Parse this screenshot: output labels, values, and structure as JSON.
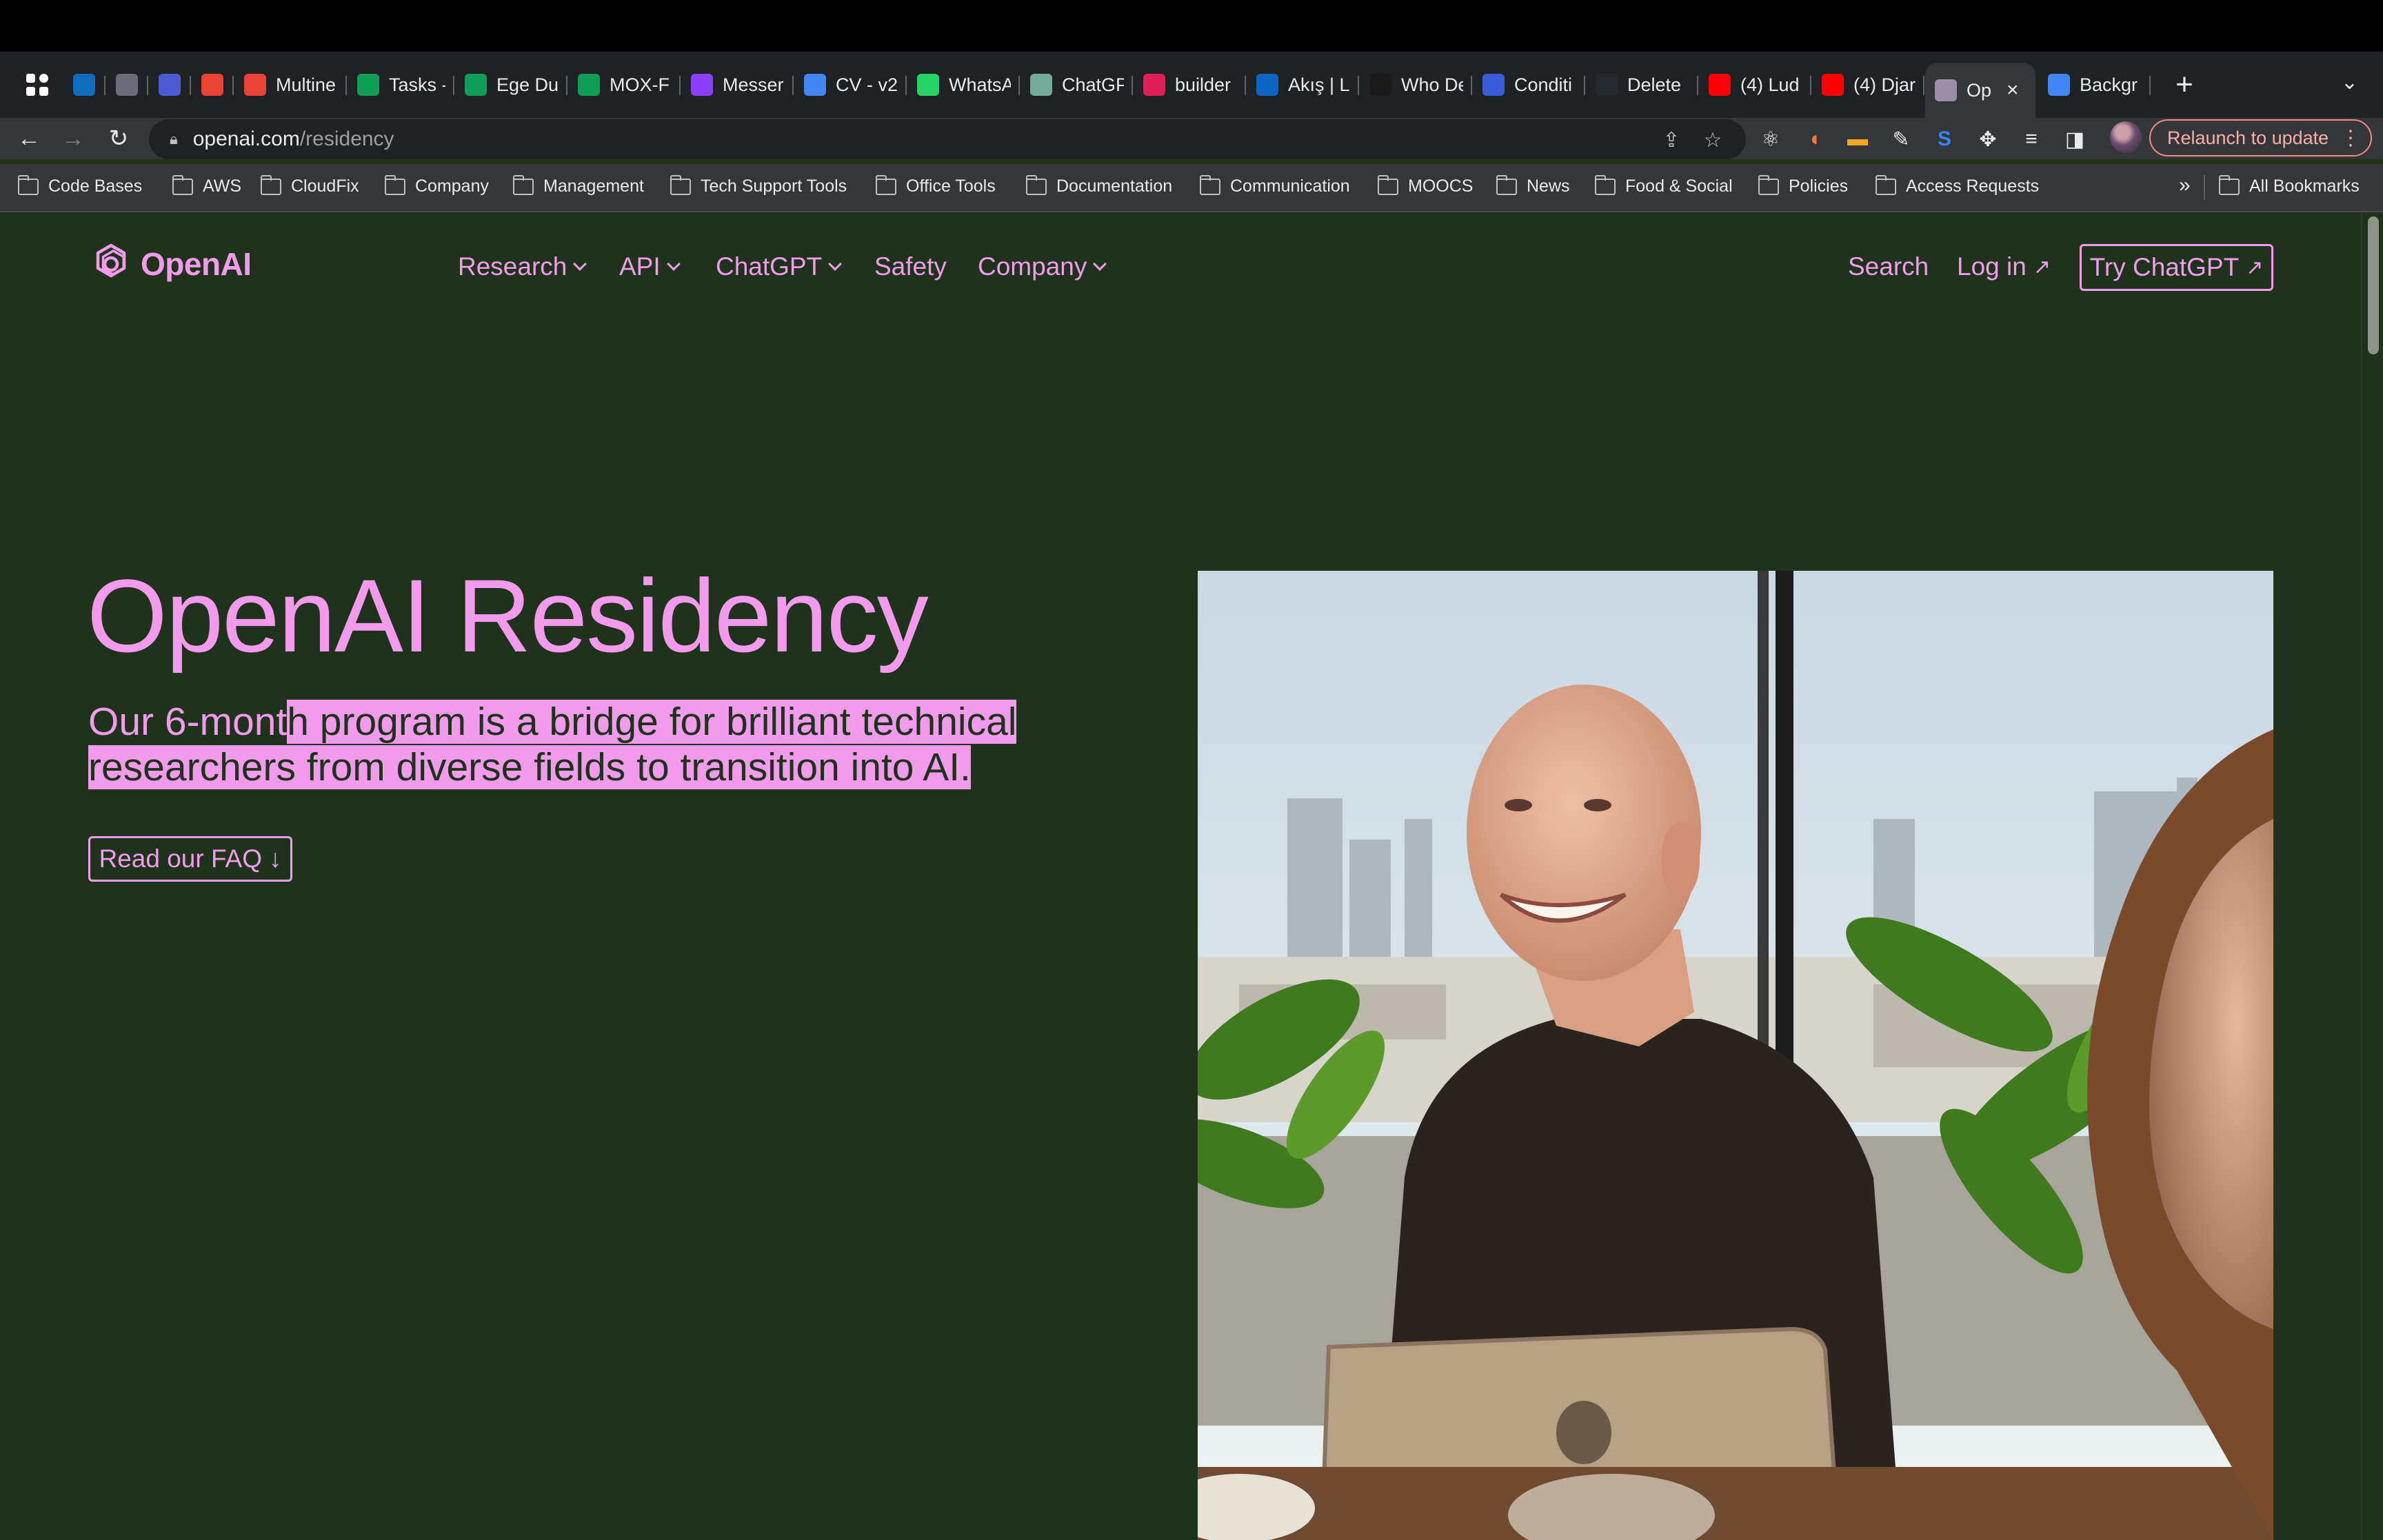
{
  "browser": {
    "tabs": [
      {
        "title": "",
        "icon": "outlook-icon",
        "color": "#0f6cbd"
      },
      {
        "title": "",
        "icon": "claude-icon",
        "color": "#6b6b7b"
      },
      {
        "title": "",
        "icon": "clockwise-icon",
        "color": "#4c5bd4"
      },
      {
        "title": "",
        "icon": "gmail-icon",
        "color": "#ea4335"
      },
      {
        "title": "Multine",
        "icon": "gmail-icon",
        "color": "#ea4335"
      },
      {
        "title": "Tasks -",
        "icon": "tasks-icon",
        "color": "#0f9d58"
      },
      {
        "title": "Ege Du",
        "icon": "sheets-icon",
        "color": "#0f9d58"
      },
      {
        "title": "MOX-F",
        "icon": "sheets-icon",
        "color": "#0f9d58"
      },
      {
        "title": "Messer",
        "icon": "messenger-icon",
        "color": "#8a3ffc"
      },
      {
        "title": "CV - v2",
        "icon": "docs-icon",
        "color": "#4285f4"
      },
      {
        "title": "WhatsA",
        "icon": "whatsapp-icon",
        "color": "#25d366"
      },
      {
        "title": "ChatGP",
        "icon": "chatgpt-icon",
        "color": "#74aa9c"
      },
      {
        "title": "builder",
        "icon": "slack-icon",
        "color": "#e01e5a"
      },
      {
        "title": "Akış | L",
        "icon": "linkedin-icon",
        "color": "#0a66c2"
      },
      {
        "title": "Who De",
        "icon": "vercel-icon",
        "color": "#1a1a1a"
      },
      {
        "title": "Conditi",
        "icon": "app-icon",
        "color": "#3b5bdb"
      },
      {
        "title": "Delete",
        "icon": "github-icon",
        "color": "#24292f"
      },
      {
        "title": "(4) Lud",
        "icon": "youtube-icon",
        "color": "#ff0000"
      },
      {
        "title": "(4) Djar",
        "icon": "youtube-icon",
        "color": "#ff0000"
      },
      {
        "title": "Op",
        "icon": "openai-icon",
        "color": "#9b8fa8",
        "active": true
      },
      {
        "title": "Backgr",
        "icon": "docs-icon",
        "color": "#4285f4"
      }
    ],
    "url_host": "openai.com",
    "url_path": "/residency",
    "relaunch_label": "Relaunch to update",
    "bookmarks": [
      "Code Bases",
      "AWS",
      "CloudFix",
      "Company",
      "Management",
      "Tech Support Tools",
      "Office Tools",
      "Documentation",
      "Communication",
      "MOOCS",
      "News",
      "Food & Social",
      "Policies",
      "Access Requests"
    ],
    "bookmarks_overflow": "»",
    "all_bookmarks": "All Bookmarks"
  },
  "site": {
    "logo_text": "OpenAI",
    "nav": [
      "Research",
      "API",
      "ChatGPT",
      "Safety",
      "Company"
    ],
    "search_label": "Search",
    "login_label": "Log in",
    "try_label": "Try ChatGPT",
    "hero_title": "OpenAI Residency",
    "hero_sub_plain": "Our 6-mont",
    "hero_sub_highlight": "h program is a bridge for brilliant technical researchers from diverse fields to transition into AI.",
    "faq_label": "Read our FAQ",
    "accent": "#f29bec",
    "background": "#1f321b"
  }
}
